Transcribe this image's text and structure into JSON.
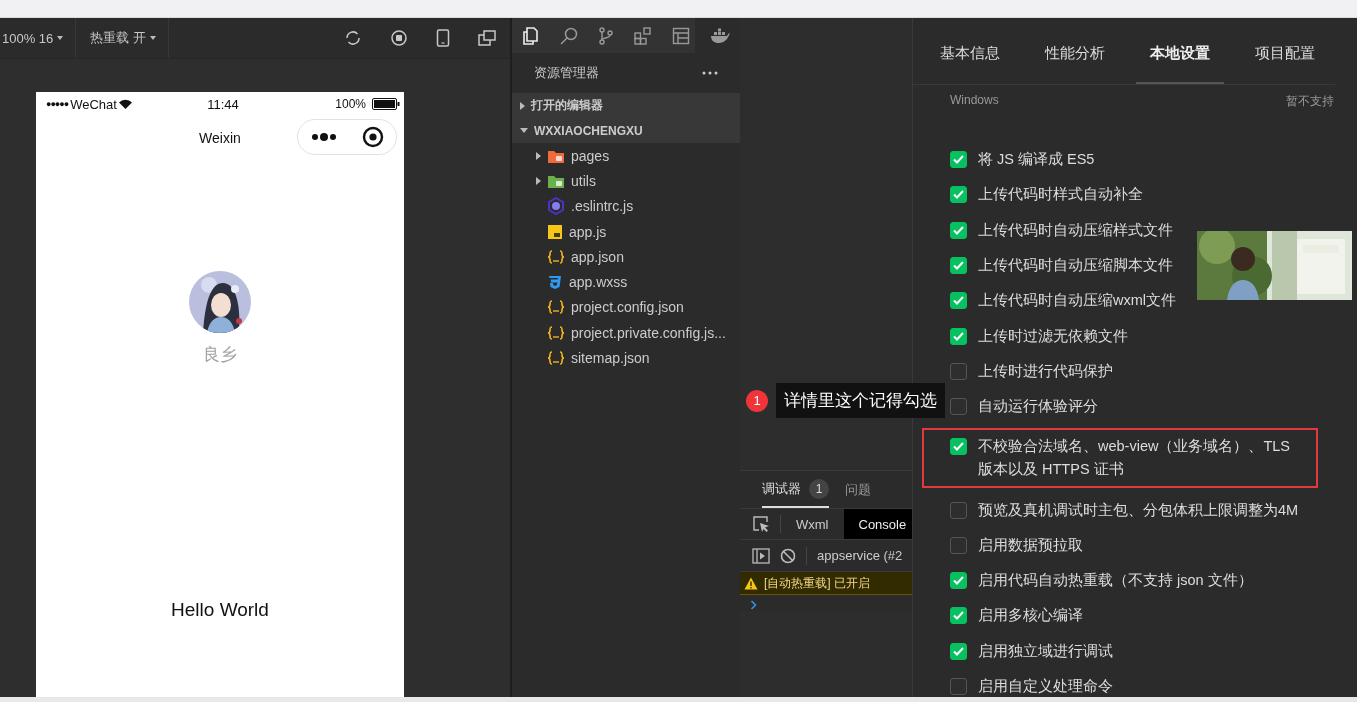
{
  "simulator": {
    "toolbar": {
      "zoom": "100% 16",
      "hot_reload": "热重载 开"
    },
    "phone": {
      "signal": "●●●●●",
      "carrier": "WeChat",
      "time": "11:44",
      "battery": "100%",
      "nav_title": "Weixin",
      "nickname": "良乡",
      "greeting": "Hello World"
    }
  },
  "explorer": {
    "title": "资源管理器",
    "sections": [
      {
        "label": "打开的编辑器",
        "expanded": false
      },
      {
        "label": "WXXIAOCHENGXU",
        "expanded": true,
        "children": [
          {
            "name": "pages",
            "kind": "folder",
            "expanded": false,
            "color": "#f06a3c"
          },
          {
            "name": "utils",
            "kind": "folder",
            "expanded": false,
            "color": "#6ab04c"
          },
          {
            "name": ".eslintrc.js",
            "kind": "eslint"
          },
          {
            "name": "app.js",
            "kind": "js"
          },
          {
            "name": "app.json",
            "kind": "json"
          },
          {
            "name": "app.wxss",
            "kind": "css"
          },
          {
            "name": "project.config.json",
            "kind": "json"
          },
          {
            "name": "project.private.config.js...",
            "kind": "json"
          },
          {
            "name": "sitemap.json",
            "kind": "json"
          }
        ]
      }
    ]
  },
  "debugger": {
    "tabs": [
      {
        "label": "调试器",
        "badge": "1",
        "selected": true
      },
      {
        "label": "问题",
        "selected": false
      }
    ],
    "subtabs": [
      {
        "label": "Wxml",
        "selected": false
      },
      {
        "label": "Console",
        "selected": true
      }
    ],
    "context": "appservice (#2",
    "log": [
      {
        "kind": "warning",
        "text": "[自动热重载] 已开启"
      }
    ]
  },
  "tooltip": {
    "badge": "1",
    "text": "详情里这个记得勾选"
  },
  "settings": {
    "tabs": [
      {
        "label": "基本信息",
        "selected": false
      },
      {
        "label": "性能分析",
        "selected": false
      },
      {
        "label": "本地设置",
        "selected": true
      },
      {
        "label": "项目配置",
        "selected": false
      }
    ],
    "platform": "Windows",
    "platform_status": "暂不支持",
    "options": [
      {
        "label": "将 JS 编译成 ES5",
        "checked": true,
        "highlighted": false
      },
      {
        "label": "上传代码时样式自动补全",
        "checked": true,
        "highlighted": false
      },
      {
        "label": "上传代码时自动压缩样式文件",
        "checked": true,
        "highlighted": false
      },
      {
        "label": "上传代码时自动压缩脚本文件",
        "checked": true,
        "highlighted": false
      },
      {
        "label": "上传代码时自动压缩wxml文件",
        "checked": true,
        "highlighted": false
      },
      {
        "label": "上传时过滤无依赖文件",
        "checked": true,
        "highlighted": false
      },
      {
        "label": "上传时进行代码保护",
        "checked": false,
        "highlighted": false
      },
      {
        "label": "自动运行体验评分",
        "checked": false,
        "highlighted": false
      },
      {
        "label": "不校验合法域名、web-view（业务域名）、TLS 版本以及 HTTPS 证书",
        "checked": true,
        "highlighted": true
      },
      {
        "label": "预览及真机调试时主包、分包体积上限调整为4M",
        "checked": false,
        "highlighted": false
      },
      {
        "label": "启用数据预拉取",
        "checked": false,
        "highlighted": false
      },
      {
        "label": "启用代码自动热重载（不支持 json 文件）",
        "checked": true,
        "highlighted": false
      },
      {
        "label": "启用多核心编译",
        "checked": true,
        "highlighted": false
      },
      {
        "label": "启用独立域进行调试",
        "checked": true,
        "highlighted": false
      },
      {
        "label": "启用自定义处理命令",
        "checked": false,
        "highlighted": false
      }
    ]
  }
}
